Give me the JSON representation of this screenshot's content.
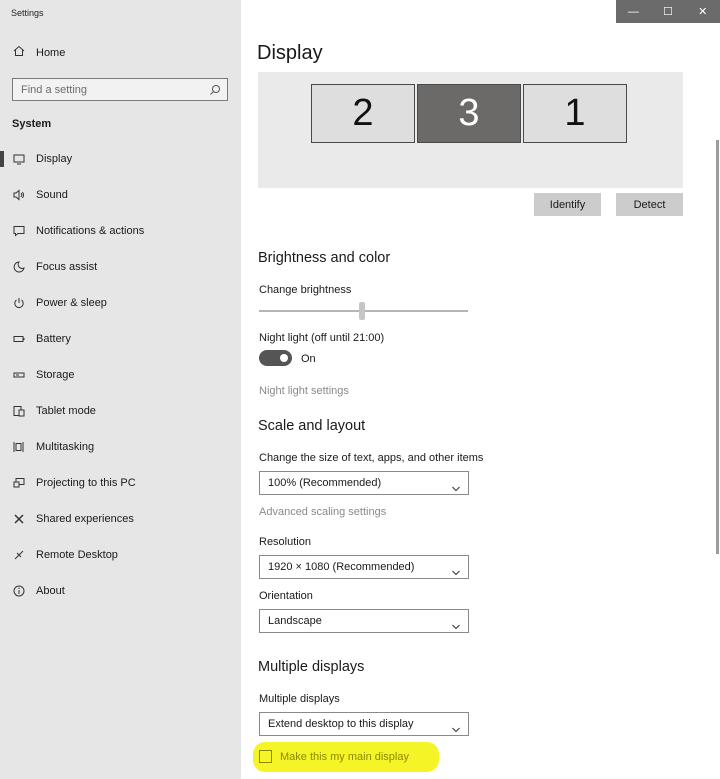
{
  "app": {
    "title": "Settings"
  },
  "titlebar": {
    "minimize": "—",
    "maximize": "☐",
    "close": "✕"
  },
  "sidebar": {
    "home": "Home",
    "search_placeholder": "Find a setting",
    "section": "System",
    "items": [
      {
        "label": "Display",
        "icon": "monitor-icon"
      },
      {
        "label": "Sound",
        "icon": "speaker-icon"
      },
      {
        "label": "Notifications & actions",
        "icon": "notification-icon"
      },
      {
        "label": "Focus assist",
        "icon": "moon-icon"
      },
      {
        "label": "Power & sleep",
        "icon": "power-icon"
      },
      {
        "label": "Battery",
        "icon": "battery-icon"
      },
      {
        "label": "Storage",
        "icon": "storage-icon"
      },
      {
        "label": "Tablet mode",
        "icon": "tablet-icon"
      },
      {
        "label": "Multitasking",
        "icon": "multitasking-icon"
      },
      {
        "label": "Projecting to this PC",
        "icon": "projecting-icon"
      },
      {
        "label": "Shared experiences",
        "icon": "shared-icon"
      },
      {
        "label": "Remote Desktop",
        "icon": "remote-desktop-icon"
      },
      {
        "label": "About",
        "icon": "info-icon"
      }
    ]
  },
  "main": {
    "title": "Display",
    "monitors": [
      "2",
      "3",
      "1"
    ],
    "identify": "Identify",
    "detect": "Detect",
    "brightness": {
      "heading": "Brightness and color",
      "change_label": "Change brightness",
      "night_light_label": "Night light (off until 21:00)",
      "toggle_state": "On",
      "night_light_link": "Night light settings"
    },
    "scale": {
      "heading": "Scale and layout",
      "size_label": "Change the size of text, apps, and other items",
      "size_value": "100% (Recommended)",
      "advanced_link": "Advanced scaling settings",
      "resolution_label": "Resolution",
      "resolution_value": "1920 × 1080 (Recommended)",
      "orientation_label": "Orientation",
      "orientation_value": "Landscape"
    },
    "multiple": {
      "heading": "Multiple displays",
      "label": "Multiple displays",
      "value": "Extend desktop to this display",
      "main_display_label": "Make this my main display"
    }
  },
  "colors": {
    "highlight": "#f2f200",
    "sidebar_bg": "#e6e6e6",
    "selected_monitor": "#6c6a69"
  }
}
